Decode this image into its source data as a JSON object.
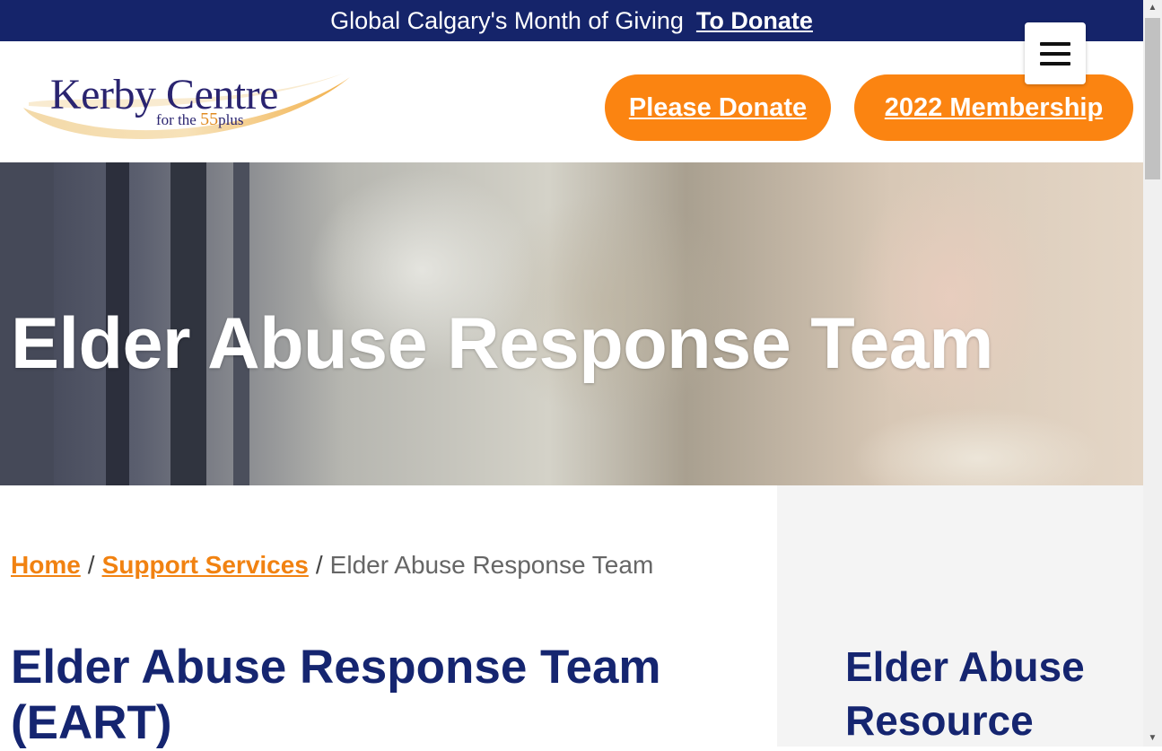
{
  "topbar": {
    "message": "Global Calgary's Month of Giving",
    "link": "To Donate"
  },
  "header": {
    "logo": {
      "name": "Kerby Centre",
      "tagline_prefix": "for the",
      "tagline_number": "55",
      "tagline_suffix": "plus"
    },
    "donate_button": "Please Donate",
    "membership_button": "2022 Membership"
  },
  "hero": {
    "title": "Elder Abuse Response Team"
  },
  "breadcrumb": {
    "home": "Home",
    "separator": "/",
    "section": "Support Services",
    "current": "Elder Abuse Response Team"
  },
  "main": {
    "title": "Elder Abuse Response Team (EART)"
  },
  "sidebar": {
    "title": "Elder Abuse Resource"
  },
  "colors": {
    "topbar_bg": "#15246a",
    "accent_orange": "#fb8411",
    "heading_navy": "#152570"
  },
  "icons": {
    "menu": "hamburger-menu-icon",
    "scroll_up": "scroll-up-arrow-icon",
    "scroll_down": "scroll-down-arrow-icon"
  }
}
